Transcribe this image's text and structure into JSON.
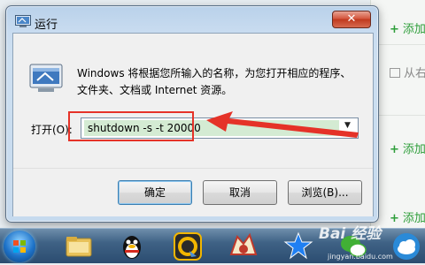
{
  "background_page": {
    "items": [
      {
        "icon": "+",
        "label": "添加"
      },
      {
        "icon": "img",
        "label": "从右"
      },
      {
        "icon": "+",
        "label": "添加"
      },
      {
        "icon": "+",
        "label": "添加"
      }
    ]
  },
  "dialog": {
    "title": "运行",
    "close_symbol": "✕",
    "description": "Windows 将根据您所输入的名称，为您打开相应的程序、文件夹、文档或 Internet 资源。",
    "open_label": "打开(O):",
    "command_value": "shutdown -s -t 20000",
    "buttons": {
      "ok": "确定",
      "cancel": "取消",
      "browse": "浏览(B)..."
    }
  },
  "annotation": {
    "color": "#e53228"
  },
  "watermark": {
    "text": "Bai 经验",
    "url": "jingyan.baidu.com"
  }
}
